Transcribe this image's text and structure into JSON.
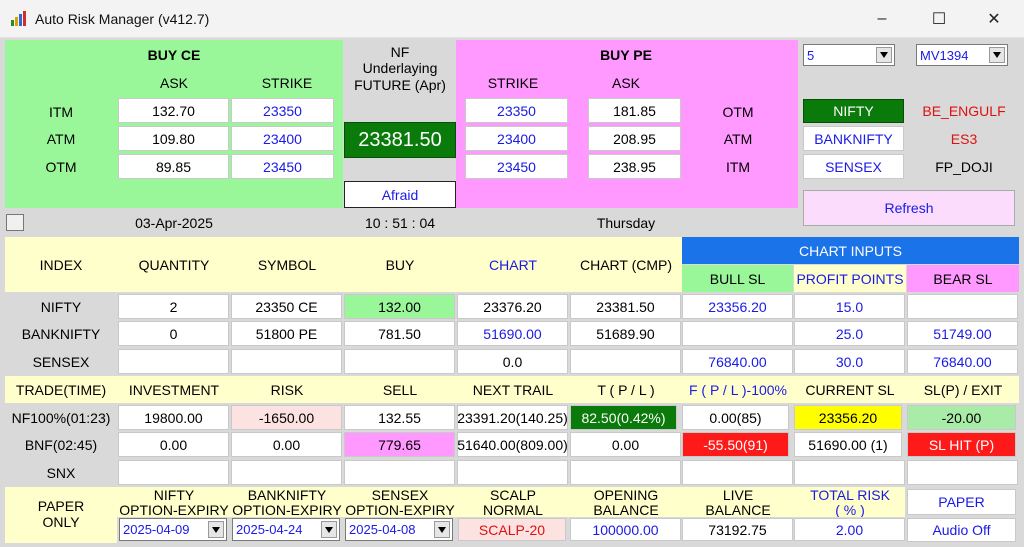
{
  "window": {
    "title": "Auto Risk Manager (v412.7)",
    "controls": {
      "minimize": "–",
      "maximize": "☐",
      "close": "✕"
    }
  },
  "top": {
    "buy_ce": {
      "title": "BUY CE",
      "ask_label": "ASK",
      "strike_label": "STRIKE",
      "rows": [
        {
          "label": "ITM",
          "ask": "132.70",
          "strike": "23350"
        },
        {
          "label": "ATM",
          "ask": "109.80",
          "strike": "23400"
        },
        {
          "label": "OTM",
          "ask": "89.85",
          "strike": "23450"
        }
      ]
    },
    "underlying": {
      "line1": "NF",
      "line2": "Underlaying",
      "line3": "FUTURE (Apr)",
      "price": "23381.50",
      "mood": "Afraid"
    },
    "buy_pe": {
      "title": "BUY PE",
      "strike_label": "STRIKE",
      "ask_label": "ASK",
      "rows": [
        {
          "label": "OTM",
          "ask": "181.85",
          "strike": "23350"
        },
        {
          "label": "ATM",
          "ask": "208.95",
          "strike": "23400"
        },
        {
          "label": "ITM",
          "ask": "238.95",
          "strike": "23450"
        }
      ]
    },
    "right": {
      "combo1": "5",
      "combo2": "MV1394",
      "index_buttons": [
        {
          "label": "NIFTY",
          "signal": "BE_ENGULF"
        },
        {
          "label": "BANKNIFTY",
          "signal": "ES3"
        },
        {
          "label": "SENSEX",
          "signal": "FP_DOJI"
        }
      ],
      "refresh": "Refresh"
    },
    "date": "03-Apr-2025",
    "time": "10 : 51 : 04",
    "day": "Thursday"
  },
  "positions": {
    "headers": {
      "index": "INDEX",
      "quantity": "QUANTITY",
      "symbol": "SYMBOL",
      "buy": "BUY",
      "chart": "CHART",
      "chart_cmp": "CHART (CMP)",
      "chart_inputs": "CHART INPUTS",
      "bull_sl": "BULL SL",
      "profit_points": "PROFIT POINTS",
      "bear_sl": "BEAR SL"
    },
    "rows": [
      {
        "index": "NIFTY",
        "quantity": "2",
        "symbol": "23350  CE",
        "buy": "132.00",
        "chart": "23376.20",
        "chart_cmp": "23381.50",
        "bull_sl": "23356.20",
        "profit_points": "15.0",
        "bear_sl": ""
      },
      {
        "index": "BANKNIFTY",
        "quantity": "0",
        "symbol": "51800  PE",
        "buy": "781.50",
        "chart": "51690.00",
        "chart_cmp": "51689.90",
        "bull_sl": "",
        "profit_points": "25.0",
        "bear_sl": "51749.00"
      },
      {
        "index": "SENSEX",
        "quantity": "",
        "symbol": "",
        "buy": "",
        "chart": "0.0",
        "chart_cmp": "",
        "bull_sl": "76840.00",
        "profit_points": "30.0",
        "bear_sl": "76840.00"
      }
    ]
  },
  "trades": {
    "headers": {
      "trade_time": "TRADE(TIME)",
      "investment": "INVESTMENT",
      "risk": "RISK",
      "sell": "SELL",
      "next_trail": "NEXT TRAIL",
      "tpl": "T ( P / L )",
      "fpl": "F ( P / L )-100%",
      "current_sl": "CURRENT SL",
      "sl_exit": "SL(P) / EXIT"
    },
    "rows": [
      {
        "trade": "NF100%(01:23)",
        "investment": "19800.00",
        "risk": "-1650.00",
        "sell": "132.55",
        "next_trail": "23391.20(140.25)",
        "tpl": "82.50(0.42%)",
        "fpl": "0.00(85)",
        "current_sl": "23356.20",
        "sl_exit": "-20.00"
      },
      {
        "trade": "BNF(02:45)",
        "investment": "0.00",
        "risk": "0.00",
        "sell": "779.65",
        "next_trail": "51640.00(809.00)",
        "tpl": "0.00",
        "fpl": "-55.50(91)",
        "current_sl": "51690.00 (1)",
        "sl_exit": "SL HIT (P)"
      },
      {
        "trade": "SNX",
        "investment": "",
        "risk": "",
        "sell": "",
        "next_trail": "",
        "tpl": "",
        "fpl": "",
        "current_sl": "",
        "sl_exit": ""
      }
    ]
  },
  "bottom": {
    "paper_only_1": "PAPER",
    "paper_only_2": "ONLY",
    "nifty_exp_1": "NIFTY",
    "nifty_exp_2": "OPTION-EXPIRY",
    "nifty_exp_val": "2025-04-09",
    "bnf_exp_1": "BANKNIFTY",
    "bnf_exp_2": "OPTION-EXPIRY",
    "bnf_exp_val": "2025-04-24",
    "snx_exp_1": "SENSEX",
    "snx_exp_2": "OPTION-EXPIRY",
    "snx_exp_val": "2025-04-08",
    "scalp_1": "SCALP",
    "scalp_2": "NORMAL",
    "scalp_val": "SCALP-20",
    "opening_1": "OPENING",
    "opening_2": "BALANCE",
    "opening_val": "100000.00",
    "live_1": "LIVE",
    "live_2": "BALANCE",
    "live_val": "73192.75",
    "risk_1": "TOTAL RISK",
    "risk_2": "( % )",
    "risk_val": "2.00",
    "paper_btn": "PAPER",
    "audio_btn": "Audio Off"
  },
  "colors": {
    "green_panel": "#99f799",
    "pink_panel": "#ff99ff",
    "cream": "#ffffcc",
    "chart_inputs": "#1a73e8",
    "bull_sl": "#99f799",
    "profit": "#ffffcc",
    "bear_sl": "#ff99ff",
    "price_green": "#0a7a0a",
    "hit_red": "#ff1a1a",
    "yellow": "#ffff00"
  }
}
